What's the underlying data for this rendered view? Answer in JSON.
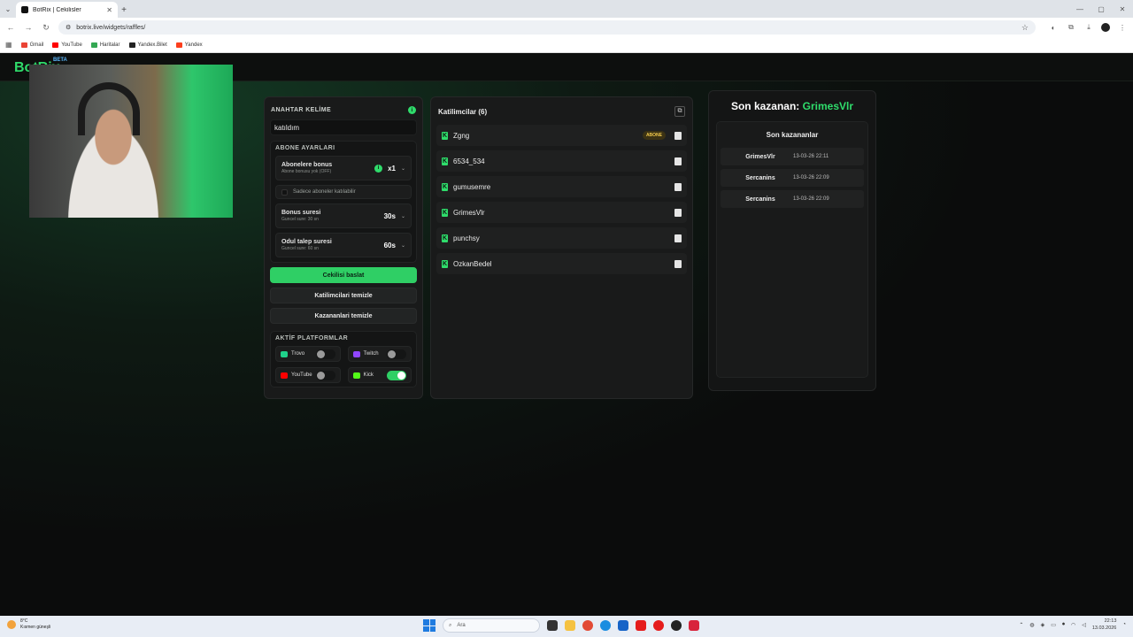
{
  "browser": {
    "tab_title": "BotRix | Cekilisler",
    "url": "botrix.live/widgets/raffles/",
    "bookmarks": [
      "Gmail",
      "YouTube",
      "Haritalar",
      "Yandex.Bilet",
      "Yandex"
    ]
  },
  "header": {
    "logo": "BotRix",
    "beta": "BETA"
  },
  "left_panel": {
    "keyword_label": "ANAHTAR KELİME",
    "keyword_value": "katıldım",
    "subscriber_settings_title": "ABONE AYARLARI",
    "sub_bonus": {
      "title": "Abonelere bonus",
      "subtitle": "Abone bonusu yok (OFF)",
      "value": "x1"
    },
    "only_subs_label": "Sadece aboneler katılabilir",
    "bonus_time": {
      "title": "Bonus suresi",
      "subtitle": "Guncel sure: 30 sn",
      "value": "30s"
    },
    "claim_time": {
      "title": "Odul talep suresi",
      "subtitle": "Guncel sure: 60 sn",
      "value": "60s"
    },
    "start_button": "Cekilisi baslat",
    "clear_participants_button": "Katilimcilari temizle",
    "clear_winners_button": "Kazananlari temizle",
    "platforms_title": "AKTİF PLATFORMLAR",
    "platforms": [
      {
        "name": "Trovo",
        "on": false,
        "color": "#1fd18a"
      },
      {
        "name": "Twitch",
        "on": false,
        "color": "#9146ff"
      },
      {
        "name": "YouTube",
        "on": false,
        "color": "#ff0000"
      },
      {
        "name": "Kick",
        "on": true,
        "color": "#53fc18"
      }
    ]
  },
  "participants": {
    "title": "Katilimcilar (6)",
    "list": [
      {
        "name": "Zgng",
        "badge": "ABONE"
      },
      {
        "name": "6534_534",
        "badge": ""
      },
      {
        "name": "gumusemre",
        "badge": ""
      },
      {
        "name": "GrimesVlr",
        "badge": ""
      },
      {
        "name": "punchsy",
        "badge": ""
      },
      {
        "name": "OzkanBedel",
        "badge": ""
      }
    ]
  },
  "winners": {
    "last_winner_label": "Son kazanan:",
    "last_winner_name": "GrimesVlr",
    "list_title": "Son kazananlar",
    "list": [
      {
        "name": "GrimesVlr",
        "time": "13-03-26 22:11"
      },
      {
        "name": "Sercanins",
        "time": "13-03-26 22:09"
      },
      {
        "name": "Sercanins",
        "time": "13-03-26 22:09"
      }
    ]
  },
  "taskbar": {
    "weather_temp": "8°C",
    "weather_desc": "Kısmen güneşli",
    "search_placeholder": "Ara",
    "time": "22:13",
    "date": "13.03.2026"
  },
  "colors": {
    "accent": "#2fdc6b",
    "background": "#111111"
  }
}
